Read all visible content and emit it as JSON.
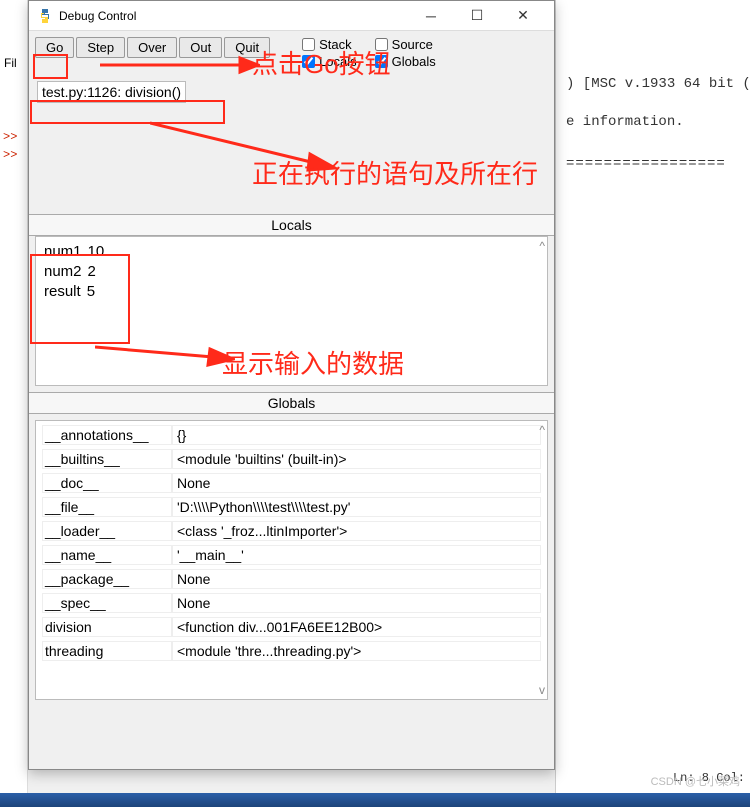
{
  "bg": {
    "line1": ") [MSC v.1933 64 bit (",
    "line2": "e information.",
    "line3": "=================",
    "ln": "Ln: 8  Col:"
  },
  "leftstrip": {
    "fi": "Fil"
  },
  "window": {
    "title": "Debug Control",
    "toolbar": {
      "go": "Go",
      "step": "Step",
      "over": "Over",
      "out": "Out",
      "quit": "Quit"
    },
    "checks": {
      "stack": "Stack",
      "source": "Source",
      "locals": "Locals",
      "globals": "Globals"
    },
    "status": "test.py:1126: division()",
    "localsHeader": "Locals",
    "globalsHeader": "Globals",
    "locals": [
      {
        "k": "num1",
        "v": "10"
      },
      {
        "k": "num2",
        "v": "2"
      },
      {
        "k": "result",
        "v": "5"
      }
    ],
    "globals": [
      {
        "k": "__annotations__",
        "v": "{}"
      },
      {
        "k": "__builtins__",
        "v": "<module 'builtins' (built-in)>"
      },
      {
        "k": "__doc__",
        "v": "None"
      },
      {
        "k": "__file__",
        "v": "'D:\\\\\\\\Python\\\\\\\\test\\\\\\\\test.py'"
      },
      {
        "k": "__loader__",
        "v": "<class '_froz...ltinImporter'>"
      },
      {
        "k": "__name__",
        "v": "'__main__'"
      },
      {
        "k": "__package__",
        "v": "None"
      },
      {
        "k": "__spec__",
        "v": "None"
      },
      {
        "k": "division",
        "v": "<function div...001FA6EE12B00>"
      },
      {
        "k": "threading",
        "v": "<module 'thre...threading.py'>"
      }
    ]
  },
  "annot": {
    "a1": "点击Go按钮",
    "a2": "正在执行的语句及所在行",
    "a3": "显示输入的数据"
  },
  "watermark": "CSDN @七小菜鸡"
}
